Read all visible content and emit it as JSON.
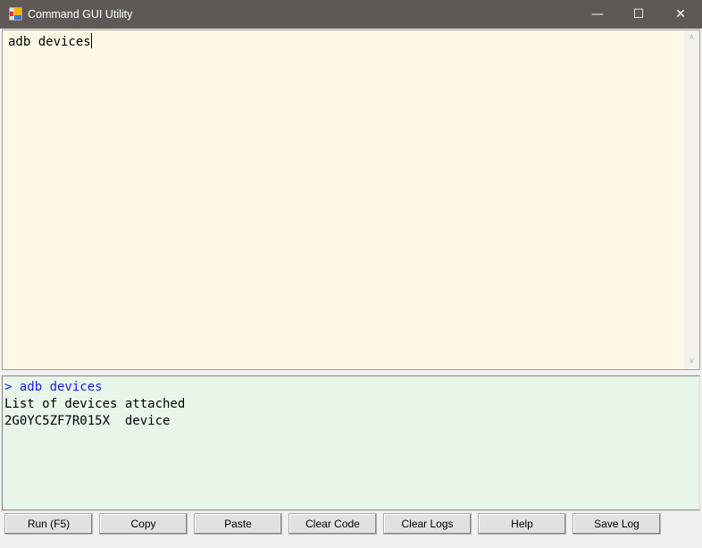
{
  "window": {
    "title": "Command GUI Utility",
    "minimize": "—",
    "maximize": "☐",
    "close": "✕"
  },
  "editor": {
    "code": "adb devices",
    "scroll_up": "∧",
    "scroll_down": "∨"
  },
  "log": {
    "lines": [
      {
        "text": "> adb devices",
        "type": "command"
      },
      {
        "text": "List of devices attached",
        "type": "output"
      },
      {
        "text": "2G0YC5ZF7R015X  device",
        "type": "output"
      }
    ]
  },
  "buttons": [
    "Run (F5)",
    "Copy",
    "Paste",
    "Clear Code",
    "Clear Logs",
    "Help",
    "Save Log"
  ],
  "colors": {
    "editor_bg": "#fff8e6",
    "log_bg": "#e8f5e9",
    "command": "#1a1aff",
    "titlebar": "#5e5955"
  }
}
